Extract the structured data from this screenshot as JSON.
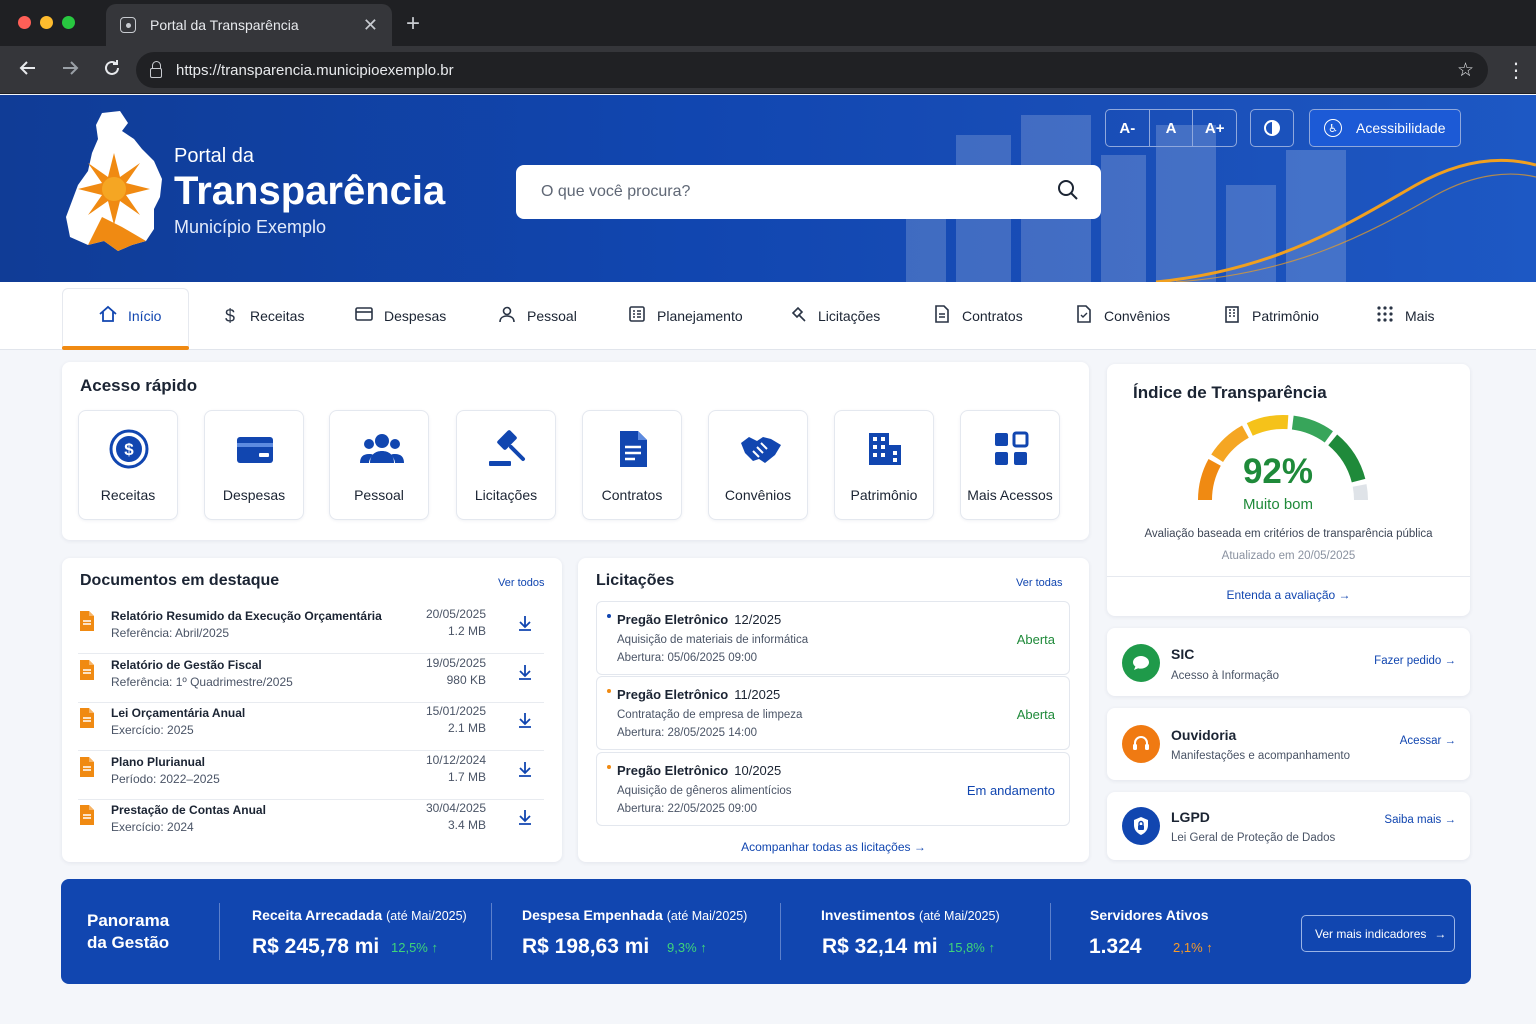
{
  "browser": {
    "tab_title": "Portal da Transparência",
    "url": "https://transparencia.municipioexemplo.br"
  },
  "header": {
    "brand_small": "Portal da",
    "brand_big": "Transparência",
    "brand_sub": "Município Exemplo",
    "search_placeholder": "O que você procura?",
    "font_decrease": "A-",
    "font_reset": "A",
    "font_increase": "A+",
    "accessibility": "Acessibilidade"
  },
  "nav": {
    "items": [
      {
        "label": "Início",
        "icon": "home-icon"
      },
      {
        "label": "Receitas",
        "icon": "dollar-icon"
      },
      {
        "label": "Despesas",
        "icon": "card-icon"
      },
      {
        "label": "Pessoal",
        "icon": "person-icon"
      },
      {
        "label": "Planejamento",
        "icon": "planning-icon"
      },
      {
        "label": "Licitações",
        "icon": "gavel-icon"
      },
      {
        "label": "Contratos",
        "icon": "document-icon"
      },
      {
        "label": "Convênios",
        "icon": "agreement-icon"
      },
      {
        "label": "Patrimônio",
        "icon": "building-icon"
      },
      {
        "label": "Mais",
        "icon": "grid-icon"
      }
    ]
  },
  "quick_access": {
    "title": "Acesso rápido",
    "items": [
      "Receitas",
      "Despesas",
      "Pessoal",
      "Licitações",
      "Contratos",
      "Convênios",
      "Patrimônio",
      "Mais Acessos"
    ]
  },
  "transparency_index": {
    "title": "Índice de Transparência",
    "score": "92%",
    "score_fraction": 0.92,
    "rating": "Muito bom",
    "note": "Avaliação baseada em critérios de transparência pública",
    "updated": "Atualizado em 20/05/2025",
    "link": "Entenda a avaliação"
  },
  "documents": {
    "title": "Documentos em destaque",
    "link": "Ver todos",
    "rows": [
      {
        "title": "Relatório Resumido da Execução Orçamentária",
        "sub": "Referência: Abril/2025",
        "date": "20/05/2025",
        "size": "1.2 MB"
      },
      {
        "title": "Relatório de Gestão Fiscal",
        "sub": "Referência: 1º Quadrimestre/2025",
        "date": "19/05/2025",
        "size": "980 KB"
      },
      {
        "title": "Lei Orçamentária Anual",
        "sub": "Exercício: 2025",
        "date": "15/01/2025",
        "size": "2.1 MB"
      },
      {
        "title": "Plano Plurianual",
        "sub": "Período: 2022–2025",
        "date": "10/12/2024",
        "size": "1.7 MB"
      },
      {
        "title": "Prestação de Contas Anual",
        "sub": "Exercício: 2024",
        "date": "30/04/2025",
        "size": "3.4 MB"
      }
    ]
  },
  "biddings": {
    "title": "Licitações",
    "link": "Ver todas",
    "footer_link": "Acompanhar todas as licitações",
    "rows": [
      {
        "type": "Pregão Eletrônico",
        "number": "12/2025",
        "desc": "Aquisição de materiais de informática",
        "opening": "Abertura: 05/06/2025 09:00",
        "status": "Aberta",
        "status_color": "#1f8a3a",
        "bullet_color": "#1146b0"
      },
      {
        "type": "Pregão Eletrônico",
        "number": "11/2025",
        "desc": "Contratação de empresa de limpeza",
        "opening": "Abertura: 28/05/2025 14:00",
        "status": "Aberta",
        "status_color": "#1f8a3a",
        "bullet_color": "#f08a12"
      },
      {
        "type": "Pregão Eletrônico",
        "number": "10/2025",
        "desc": "Aquisição de gêneros alimentícios",
        "opening": "Abertura: 22/05/2025 09:00",
        "status": "Em andamento",
        "status_color": "#1146b0",
        "bullet_color": "#f08a12"
      }
    ]
  },
  "services": [
    {
      "title": "SIC",
      "sub": "Acesso à Informação",
      "link": "Fazer pedido",
      "icon": "chat-icon",
      "color": "#1f9a4a"
    },
    {
      "title": "Ouvidoria",
      "sub": "Manifestações e acompanhamento",
      "link": "Acessar",
      "icon": "headset-icon",
      "color": "#f07a12"
    },
    {
      "title": "LGPD",
      "sub": "Lei Geral de Proteção de Dados",
      "link": "Saiba mais",
      "icon": "shield-lock-icon",
      "color": "#1146b0"
    }
  ],
  "panorama": {
    "title_line1": "Panorama",
    "title_line2": "da Gestão",
    "metrics": [
      {
        "label": "Receita Arrecadada",
        "period": "(até Mai/2025)",
        "value": "R$ 245,78 mi",
        "change": "12,5%",
        "color": "#3ed47a"
      },
      {
        "label": "Despesa Empenhada",
        "period": "(até Mai/2025)",
        "value": "R$ 198,63 mi",
        "change": "9,3%",
        "color": "#3ed47a"
      },
      {
        "label": "Investimentos",
        "period": "(até Mai/2025)",
        "value": "R$ 32,14 mi",
        "change": "15,8%",
        "color": "#3ed47a"
      },
      {
        "label": "Servidores Ativos",
        "period": "",
        "value": "1.324",
        "change": "2,1%",
        "color": "#f59a2a"
      }
    ],
    "more_button": "Ver mais indicadores"
  },
  "colors": {
    "primary": "#1146b0",
    "accent": "#f08a12",
    "success": "#1f8a3a"
  }
}
